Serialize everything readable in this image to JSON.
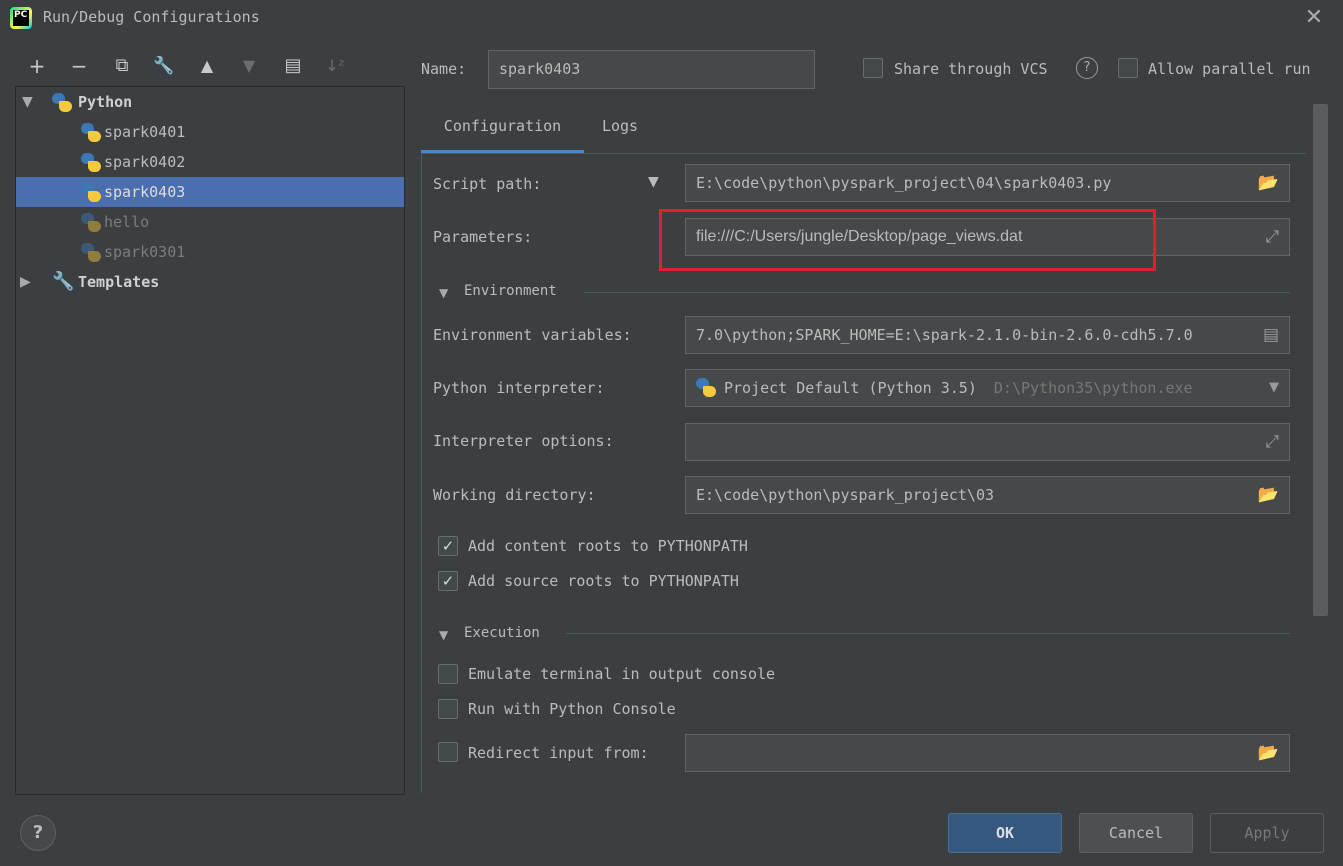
{
  "window": {
    "title": "Run/Debug Configurations",
    "logo_text": "PC"
  },
  "toolbar": {
    "add": "+",
    "remove": "−",
    "copy": "⧉",
    "edit": "🔧",
    "up": "▲",
    "down": "▼",
    "folder": "▤",
    "sort": "↓ᶻ"
  },
  "tree": {
    "python_group": "Python",
    "items": [
      "spark0401",
      "spark0402",
      "spark0403",
      "hello",
      "spark0301"
    ],
    "templates": "Templates"
  },
  "header": {
    "name_label": "Name:",
    "name_value": "spark0403",
    "share_vcs": "Share through VCS",
    "help_glyph": "?",
    "allow_parallel": "Allow parallel run"
  },
  "tabs": [
    "Configuration",
    "Logs"
  ],
  "form": {
    "script_path_label": "Script path:",
    "script_path_value": "E:\\code\\python\\pyspark_project\\04\\spark0403.py",
    "parameters_label": "Parameters:",
    "parameters_value": "file:///C:/Users/jungle/Desktop/page_views.dat",
    "environment_section": "Environment",
    "env_vars_label": "Environment variables:",
    "env_vars_value": "7.0\\python;SPARK_HOME=E:\\spark-2.1.0-bin-2.6.0-cdh5.7.0",
    "interpreter_label": "Python interpreter:",
    "interpreter_value": "Project Default (Python 3.5)",
    "interpreter_path": "D:\\Python35\\python.exe",
    "interp_options_label": "Interpreter options:",
    "interp_options_value": "",
    "working_dir_label": "Working directory:",
    "working_dir_value": "E:\\code\\python\\pyspark_project\\03",
    "add_content_roots": "Add content roots to PYTHONPATH",
    "add_source_roots": "Add source roots to PYTHONPATH",
    "execution_section": "Execution",
    "emulate_terminal": "Emulate terminal in output console",
    "run_python_console": "Run with Python Console",
    "redirect_input": "Redirect input from:",
    "redirect_input_value": ""
  },
  "checks": {
    "check_mark": "✓",
    "share_vcs": false,
    "allow_parallel": false,
    "add_content_roots": true,
    "add_source_roots": true,
    "emulate_terminal": false,
    "run_python_console": false,
    "redirect_input": false
  },
  "footer": {
    "help": "?",
    "ok": "OK",
    "cancel": "Cancel",
    "apply": "Apply"
  },
  "colors": {
    "background": "#3c3f41",
    "selection": "#4b6eaf",
    "tab_underline": "#4a88c7",
    "highlight_box": "#e0212c",
    "primary_button": "#365880"
  }
}
